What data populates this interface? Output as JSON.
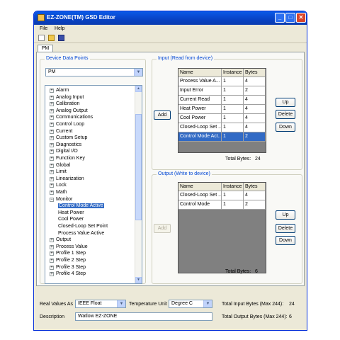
{
  "window": {
    "title": "EZ-ZONE(TM) GSD Editor",
    "controls": {
      "minimize": "_",
      "maximize": "□",
      "close": "✕"
    }
  },
  "menu": [
    "File",
    "Help"
  ],
  "tabs": [
    "PM"
  ],
  "device_data_points": {
    "group_label": "Device Data Points",
    "selected_model": "PM",
    "tree": [
      {
        "label": "Alarm",
        "expander": "+",
        "level": 0
      },
      {
        "label": "Analog Input",
        "expander": "+",
        "level": 0
      },
      {
        "label": "Calibration",
        "expander": "+",
        "level": 0
      },
      {
        "label": "Analog Output",
        "expander": "+",
        "level": 0
      },
      {
        "label": "Communications",
        "expander": "+",
        "level": 0
      },
      {
        "label": "Control Loop",
        "expander": "+",
        "level": 0
      },
      {
        "label": "Current",
        "expander": "+",
        "level": 0
      },
      {
        "label": "Custom Setup",
        "expander": "+",
        "level": 0
      },
      {
        "label": "Diagnostics",
        "expander": "+",
        "level": 0
      },
      {
        "label": "Digital I/O",
        "expander": "+",
        "level": 0
      },
      {
        "label": "Function Key",
        "expander": "+",
        "level": 0
      },
      {
        "label": "Global",
        "expander": "+",
        "level": 0
      },
      {
        "label": "Limit",
        "expander": "+",
        "level": 0
      },
      {
        "label": "Linearization",
        "expander": "+",
        "level": 0
      },
      {
        "label": "Lock",
        "expander": "+",
        "level": 0
      },
      {
        "label": "Math",
        "expander": "+",
        "level": 0
      },
      {
        "label": "Monitor",
        "expander": "−",
        "level": 0
      },
      {
        "label": "Control Mode Active",
        "expander": "",
        "level": 1,
        "selected": true
      },
      {
        "label": "Heat Power",
        "expander": "",
        "level": 1
      },
      {
        "label": "Cool Power",
        "expander": "",
        "level": 1
      },
      {
        "label": "Closed-Loop Set Point",
        "expander": "",
        "level": 1
      },
      {
        "label": "Process Value Active",
        "expander": "",
        "level": 1
      },
      {
        "label": "Output",
        "expander": "+",
        "level": 0
      },
      {
        "label": "Process Value",
        "expander": "+",
        "level": 0
      },
      {
        "label": "Profile 1 Step",
        "expander": "+",
        "level": 0
      },
      {
        "label": "Profile 2 Step",
        "expander": "+",
        "level": 0
      },
      {
        "label": "Profile 3 Step",
        "expander": "+",
        "level": 0
      },
      {
        "label": "Profile 4 Step",
        "expander": "+",
        "level": 0
      }
    ]
  },
  "input": {
    "group_label": "Input (Read from device)",
    "add_label": "Add",
    "headers": [
      "Name",
      "Instance",
      "Bytes"
    ],
    "rows": [
      [
        "Process Value A...",
        "1",
        "4"
      ],
      [
        "Input Error",
        "1",
        "2"
      ],
      [
        "Current Read",
        "1",
        "4"
      ],
      [
        "Heat Power",
        "1",
        "4"
      ],
      [
        "Cool Power",
        "1",
        "4"
      ],
      [
        "Closed-Loop Set ...",
        "1",
        "4"
      ],
      [
        "Control Mode Act...",
        "1",
        "2"
      ]
    ],
    "selected_row": 6,
    "total_label": "Total Bytes:",
    "total_value": "24",
    "buttons": {
      "up": "Up",
      "delete": "Delete",
      "down": "Down"
    }
  },
  "output": {
    "group_label": "Output (Write to device)",
    "add_label": "Add",
    "headers": [
      "Name",
      "Instance",
      "Bytes"
    ],
    "rows": [
      [
        "Closed-Loop Set ...",
        "1",
        "4"
      ],
      [
        "Control Mode",
        "1",
        "2"
      ]
    ],
    "total_label": "Total Bytes:",
    "total_value": "6",
    "buttons": {
      "up": "Up",
      "delete": "Delete",
      "down": "Down"
    }
  },
  "bottom": {
    "real_values_label": "Real Values As",
    "real_values_value": "IEEE Float",
    "temp_unit_label": "Temperature Unit",
    "temp_unit_value": "Degree C",
    "total_input_label": "Total Input Bytes (Max 244):",
    "total_input_value": "24",
    "description_label": "Description",
    "description_value": "Watlow EZ-ZONE",
    "total_output_label": "Total Output Bytes (Max 244):",
    "total_output_value": "6"
  },
  "icons": [
    "app-icon",
    "new-file-icon",
    "open-folder-icon",
    "save-disk-icon",
    "chevron-down-icon",
    "scroll-up-icon",
    "scroll-down-icon"
  ]
}
